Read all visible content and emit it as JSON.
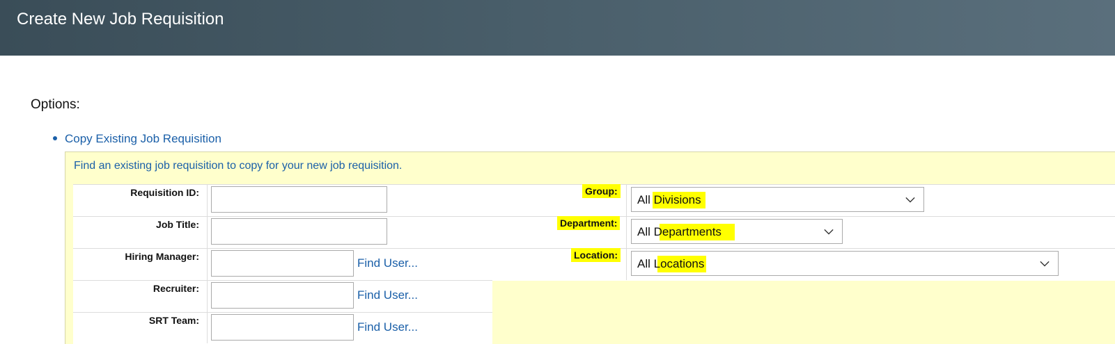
{
  "header": {
    "title": "Create New Job Requisition"
  },
  "options_label": "Options:",
  "copy_link": "Copy Existing Job Requisition",
  "panel": {
    "description": "Find an existing job requisition to copy for your new job requisition."
  },
  "fields": {
    "requisition_id": {
      "label": "Requisition ID:",
      "value": ""
    },
    "job_title": {
      "label": "Job Title:",
      "value": ""
    },
    "hiring_manager": {
      "label": "Hiring Manager:",
      "value": "",
      "find": "Find User..."
    },
    "recruiter": {
      "label": "Recruiter:",
      "value": "",
      "find": "Find User..."
    },
    "srt_team": {
      "label": "SRT Team:",
      "value": "",
      "find": "Find User..."
    }
  },
  "filters": {
    "group": {
      "label": "Group:",
      "selected": "All Divisions"
    },
    "department": {
      "label": "Department:",
      "selected": "All Departments"
    },
    "location": {
      "label": "Location:",
      "selected": "All Locations"
    }
  },
  "colors": {
    "header": "#4a5f6b",
    "link": "#1a5fa8",
    "panel": "#ffffcc",
    "highlight": "#ffff00"
  },
  "icons": {
    "select_arrow": "chevron-down-icon"
  }
}
